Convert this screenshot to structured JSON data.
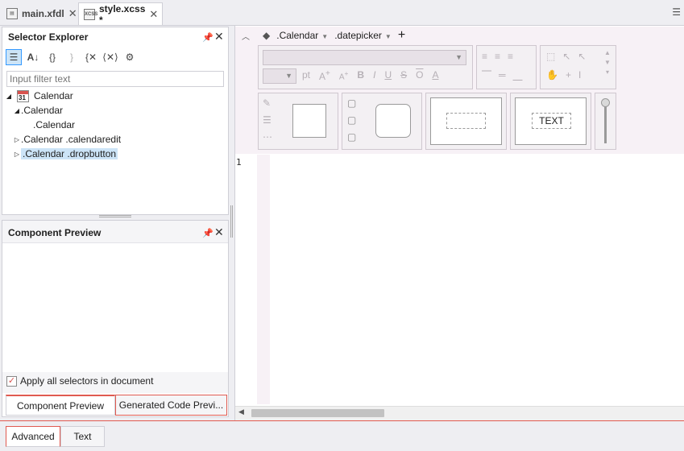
{
  "doc_tabs": [
    {
      "icon": "xfdl-file-icon",
      "label": "main.xfdl",
      "close": "✕"
    },
    {
      "icon": "xcss-file-icon",
      "icon_text": "XCSS",
      "label": "style.xcss *",
      "close": "✕"
    }
  ],
  "selector_explorer": {
    "title": "Selector Explorer",
    "filter_placeholder": "Input filter text",
    "tree": [
      {
        "label": "Calendar",
        "cal_num": "31"
      },
      {
        "label": ".Calendar"
      },
      {
        "label": ".Calendar"
      },
      {
        "label": ".Calendar .calendaredit"
      },
      {
        "label": ".Calendar .dropbutton"
      }
    ]
  },
  "component_preview": {
    "title": "Component Preview",
    "apply_label": "Apply all selectors in document",
    "tabs": [
      "Component Preview",
      "Generated Code Previ..."
    ]
  },
  "editor": {
    "breadcrumbs": [
      ".Calendar",
      ".datepicker"
    ],
    "font_size_unit": "pt",
    "text_preview": "TEXT",
    "line_numbers": [
      "1"
    ]
  },
  "bottom_tabs": [
    "Advanced",
    "Text"
  ]
}
